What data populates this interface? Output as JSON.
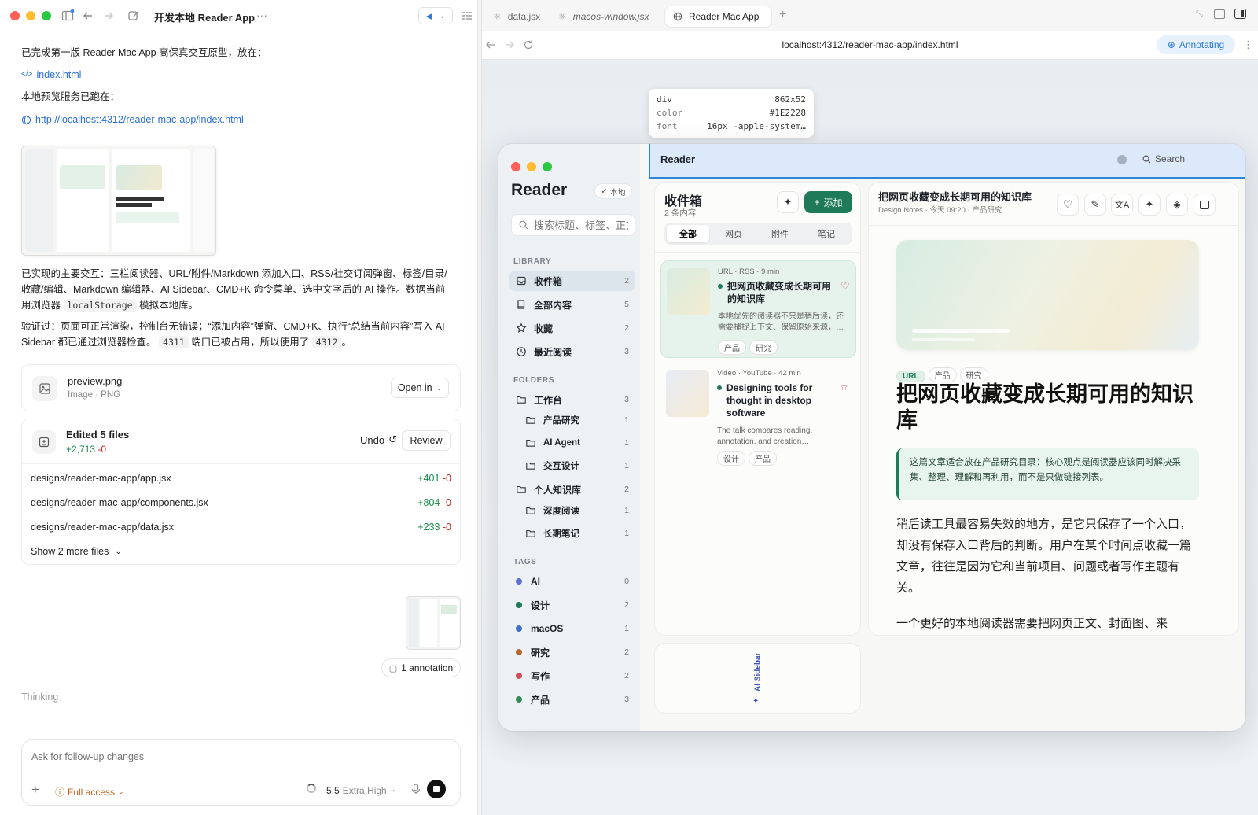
{
  "left": {
    "title": "开发本地 Reader App",
    "msg1": "已完成第一版 Reader Mac App 高保真交互原型，放在：",
    "file_link": "index.html",
    "msg2": "本地预览服务已跑在：",
    "url_link": "http://localhost:4312/reader-mac-app/index.html",
    "msg3a": "已实现的主要交互：三栏阅读器、URL/附件/Markdown 添加入口、RSS/社交订阅弹窗、标签/目录/收藏/编辑、Markdown 编辑器、AI Sidebar、CMD+K 命令菜单、选中文字后的 AI 操作。数据当前用浏览器",
    "msg3_code": "localStorage",
    "msg3b": "模拟本地库。",
    "msg4a": "验证过：页面可正常渲染，控制台无错误；“添加内容”弹窗、CMD+K、执行“总结当前内容”写入 AI Sidebar 都已通过浏览器检查。",
    "msg4_code1": "4311",
    "msg4b": "端口已被占用，所以使用了",
    "msg4_code2": "4312",
    "msg4c": "。",
    "attachment": {
      "name": "preview.png",
      "meta": "Image · PNG",
      "button": "Open in"
    },
    "edits": {
      "title": "Edited 5 files",
      "added": "+2,713",
      "removed": "-0",
      "undo": "Undo",
      "review": "Review",
      "files": [
        {
          "path": "designs/reader-mac-app/app.jsx",
          "add": "+401",
          "del": "-0"
        },
        {
          "path": "designs/reader-mac-app/components.jsx",
          "add": "+804",
          "del": "-0"
        },
        {
          "path": "designs/reader-mac-app/data.jsx",
          "add": "+233",
          "del": "-0"
        }
      ],
      "more": "Show 2 more files"
    },
    "annotation": "1 annotation",
    "thinking": "Thinking",
    "composer": {
      "placeholder": "Ask for follow-up changes",
      "access": "Full access",
      "model": "5.5",
      "effort": "Extra High"
    }
  },
  "browser": {
    "tabs": [
      {
        "label": "data.jsx",
        "icon": "react-icon"
      },
      {
        "label": "macos-window.jsx",
        "icon": "react-icon"
      },
      {
        "label": "Reader Mac App",
        "icon": "globe-icon"
      }
    ],
    "url": "localhost:4312/reader-mac-app/index.html",
    "annotating": "Annotating",
    "inspector": {
      "tag": "div",
      "size": "862x52",
      "color_label": "color",
      "color": "#1E2228",
      "font_label": "font",
      "font": "16px -apple-system…"
    }
  },
  "reader": {
    "header_title": "Reader",
    "search": "Search",
    "app_name": "Reader",
    "local_badge": "本地",
    "search_placeholder": "搜索标题、标签、正文",
    "library_heading": "LIBRARY",
    "library": [
      {
        "label": "收件箱",
        "count": "2",
        "icon": "inbox-icon",
        "active": true
      },
      {
        "label": "全部内容",
        "count": "5",
        "icon": "book-icon"
      },
      {
        "label": "收藏",
        "count": "2",
        "icon": "star-icon"
      },
      {
        "label": "最近阅读",
        "count": "3",
        "icon": "clock-icon"
      }
    ],
    "folders_heading": "FOLDERS",
    "folders": [
      {
        "label": "工作台",
        "count": "3",
        "sub": false
      },
      {
        "label": "产品研究",
        "count": "1",
        "sub": true
      },
      {
        "label": "AI Agent",
        "count": "1",
        "sub": true
      },
      {
        "label": "交互设计",
        "count": "1",
        "sub": true
      },
      {
        "label": "个人知识库",
        "count": "2",
        "sub": false
      },
      {
        "label": "深度阅读",
        "count": "1",
        "sub": true
      },
      {
        "label": "长期笔记",
        "count": "1",
        "sub": true
      }
    ],
    "tags_heading": "TAGS",
    "tags": [
      {
        "label": "AI",
        "count": "0",
        "color": "#5b6fd6"
      },
      {
        "label": "设计",
        "count": "2",
        "color": "#1f7a5a"
      },
      {
        "label": "macOS",
        "count": "1",
        "color": "#3d6fd0"
      },
      {
        "label": "研究",
        "count": "2",
        "color": "#b8642a"
      },
      {
        "label": "写作",
        "count": "2",
        "color": "#d24a5a"
      },
      {
        "label": "产品",
        "count": "3",
        "color": "#2f8a5a"
      }
    ],
    "list": {
      "title": "收件箱",
      "subtitle": "2 条内容",
      "add_button": "添加",
      "filters": [
        "全部",
        "网页",
        "附件",
        "笔记"
      ],
      "items": [
        {
          "source": "URL",
          "feed": "RSS",
          "time": "9 min",
          "title": "把网页收藏变成长期可用的知识库",
          "excerpt": "本地优先的阅读器不只是稍后读，还需要捕捉上下文、保留原始来源，…",
          "tags": [
            "产品",
            "研究"
          ]
        },
        {
          "source": "Video",
          "feed": "YouTube",
          "time": "42 min",
          "title": "Designing tools for thought in desktop software",
          "excerpt": "The talk compares reading, annotation, and creation…",
          "tags": [
            "设计",
            "产品"
          ]
        }
      ]
    },
    "ai_sidebar": "AI Sidebar",
    "article": {
      "title": "把网页收藏变成长期可用的知识库",
      "source": "Design Notes",
      "date": "今天 09:20",
      "folder": "产品研究",
      "chips": [
        "URL",
        "产品",
        "研究"
      ],
      "headline": "把网页收藏变成长期可用的知识库",
      "callout": "这篇文章适合放在产品研究目录：核心观点是阅读器应该同时解决采集、整理、理解和再利用，而不是只做链接列表。",
      "p1": "稍后读工具最容易失效的地方，是它只保存了一个入口，却没有保存入口背后的判断。用户在某个时间点收藏一篇文章，往往是因为它和当前项目、问题或者写作主题有关。",
      "p2": "一个更好的本地阅读器需要把网页正文、封面图、来"
    }
  },
  "colors": {
    "accent": "#2a6fd6",
    "green": "#1f7a5a",
    "highlight": "#dce9fb",
    "highlight_border": "#2f86d8"
  }
}
